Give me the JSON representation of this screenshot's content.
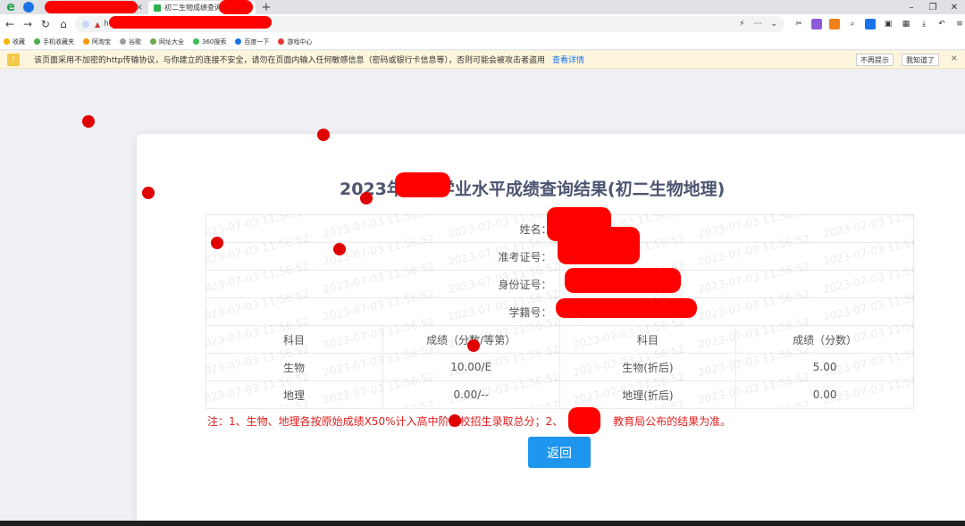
{
  "browser": {
    "brand_glyph": "e",
    "tabs": [
      {
        "title": "",
        "close": "×"
      },
      {
        "title": "初二生物成绩查询",
        "close": "×"
      }
    ],
    "new_tab": "+",
    "address": {
      "url": "http"
    },
    "window_controls": {
      "minimize": "–",
      "restore": "❐",
      "close": "✕"
    },
    "bookmarks": [
      {
        "label": "收藏",
        "color": "#f4b400"
      },
      {
        "label": "手机收藏夹",
        "color": "#4caf50"
      },
      {
        "label": "阿淘宝",
        "color": "#ff9800"
      },
      {
        "label": "谷歌",
        "color": "#9e9e9e"
      },
      {
        "label": "网址大全",
        "color": "#6aa84f"
      },
      {
        "label": "360搜索",
        "color": "#3cba54"
      },
      {
        "label": "百度一下",
        "color": "#1a73e8"
      },
      {
        "label": "游戏中心",
        "color": "#e53935"
      }
    ]
  },
  "security_bar": {
    "message": "该页面采用不加密的http传输协议，与你建立的连接不安全，请勿在页面内输入任何敏感信息（密码或银行卡信息等），否则可能会被攻击者盗用",
    "link": "查看详情",
    "no_remind": "不再提示",
    "got_it": "我知道了",
    "close": "×"
  },
  "page": {
    "title": "2023年初中学业水平成绩查询结果(初二生物地理)",
    "watermark": "2023-07-03 11:56:52",
    "info_labels": {
      "name": "姓名：",
      "exam_no": "准考证号：",
      "id_no": "身份证号：",
      "student_no": "学籍号："
    },
    "table": {
      "headers": [
        "科目",
        "成绩（分数/等第）",
        "科目",
        "成绩（分数）"
      ],
      "rows": [
        [
          "生物",
          "10.00/E",
          "生物(折后)",
          "5.00"
        ],
        [
          "地理",
          "0.00/--",
          "地理(折后)",
          "0.00"
        ]
      ]
    },
    "note_part1": "注：1、生物、地理各按原始成绩X50%计入高中阶段",
    "note_part2": "校招生录取总分；2、",
    "note_part3": "教育局公布的结果为准。",
    "back_label": "返回"
  },
  "colors": {
    "accent": "#1e96ee",
    "note_red": "#e02020",
    "title": "#4c5570",
    "redaction": "#ff0000"
  }
}
